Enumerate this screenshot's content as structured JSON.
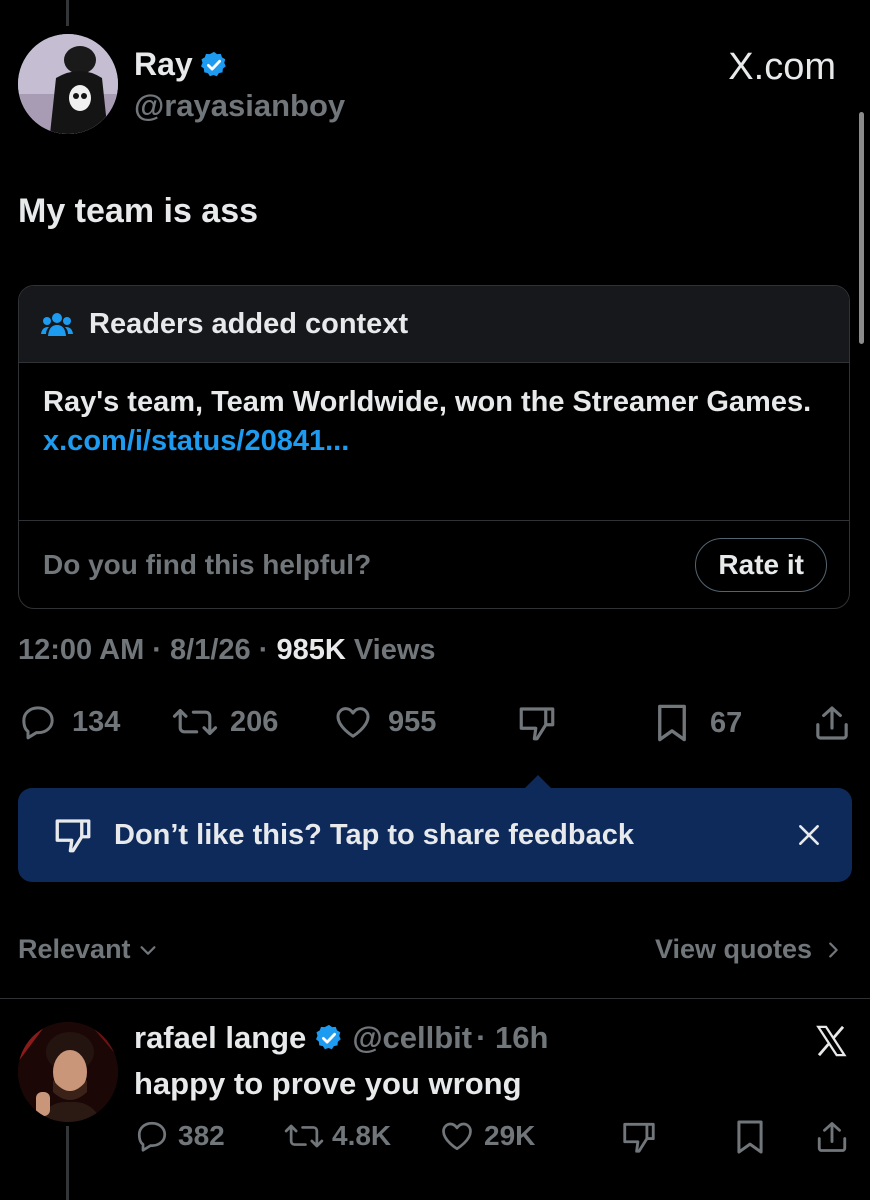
{
  "tweet": {
    "author_name": "Ray",
    "author_handle": "@rayasianboy",
    "brand": "X.com",
    "text": "My team is ass",
    "timestamp": "12:00 AM · 8/1/26 · ",
    "views_count": "985K",
    "views_label": " Views"
  },
  "community_note": {
    "title": "Readers added context",
    "body": "Ray's team, Team Worldwide, won the Streamer Games.",
    "link": "x.com/i/status/20841...",
    "question": "Do you find this helpful?",
    "rate_button": "Rate it"
  },
  "actions": {
    "replies": "134",
    "reposts": "206",
    "likes": "955",
    "bookmarks": "67"
  },
  "feedback": {
    "text": "Don’t like this? Tap to share feedback"
  },
  "replies_bar": {
    "sort_label": "Relevant",
    "view_quotes": "View quotes"
  },
  "reply": {
    "author_name": "rafael lange",
    "author_handle": "@cellbit",
    "time": "· 16h",
    "text": "happy to prove you wrong",
    "replies": "382",
    "reposts": "4.8K",
    "likes": "29K"
  },
  "colors": {
    "background": "#000000",
    "accent": "#1d9bf0",
    "feedback_bg": "#0d2a5b",
    "muted": "#71767b"
  },
  "icons": [
    "verified-badge-icon",
    "x-logo-icon",
    "people-icon",
    "reply-icon",
    "repost-icon",
    "like-icon",
    "dislike-icon",
    "bookmark-icon",
    "share-icon",
    "close-icon",
    "chevron-down-icon",
    "chevron-right-icon"
  ]
}
